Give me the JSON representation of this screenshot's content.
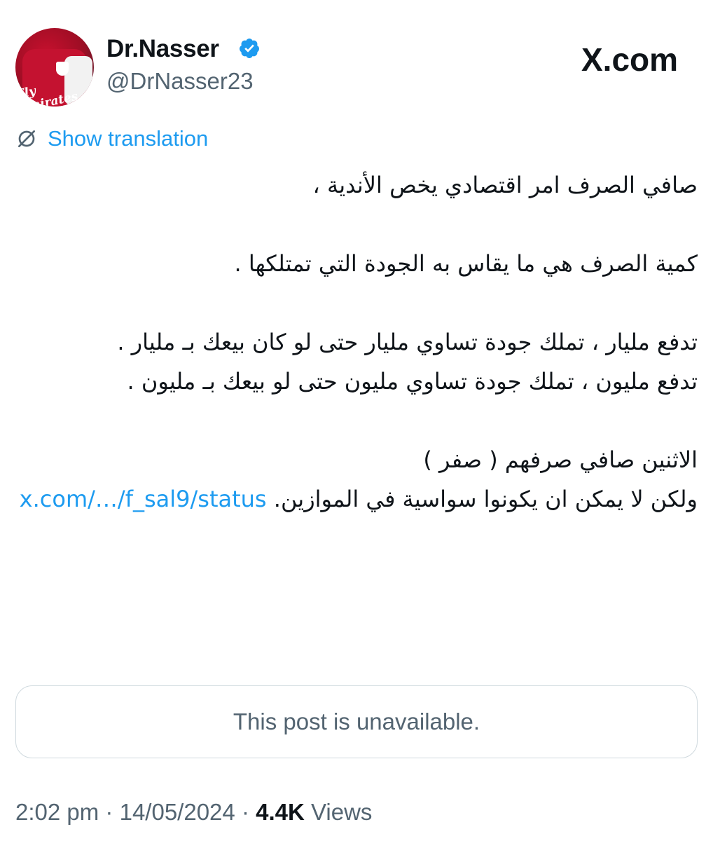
{
  "header": {
    "display_name": "Dr.Nasser",
    "handle": "@DrNasser23",
    "verified_icon": "verified-badge-icon",
    "verified_color": "#1d9bf0",
    "site_logo": "X.com",
    "avatar_icon": "arsenal-shirt-avatar"
  },
  "translate": {
    "label": "Show translation",
    "icon": "globe-translate-icon",
    "color": "#1d9bf0"
  },
  "tweet": {
    "line1": "صافي الصرف امر اقتصادي يخص الأندية ،",
    "line2": "كمية الصرف هي ما يقاس به الجودة التي تمتلكها .",
    "line3": "تدفع مليار ، تملك جودة تساوي مليار حتى لو كان بيعك بـ مليار .",
    "line4": "تدفع مليون ، تملك جودة تساوي مليون حتى لو بيعك بـ مليون .",
    "line5": "الاثنين صافي صرفهم ( صفر )",
    "line6": "ولكن لا يمكن ان يكونوا سواسية في الموازين.",
    "link": "x.com/…/f_sal9/status"
  },
  "quoted_post": {
    "message": "This post is unavailable."
  },
  "meta": {
    "time": "2:02 pm",
    "date": "14/05/2024",
    "views_count": "4.4K",
    "views_label": "Views",
    "separator": "·"
  }
}
